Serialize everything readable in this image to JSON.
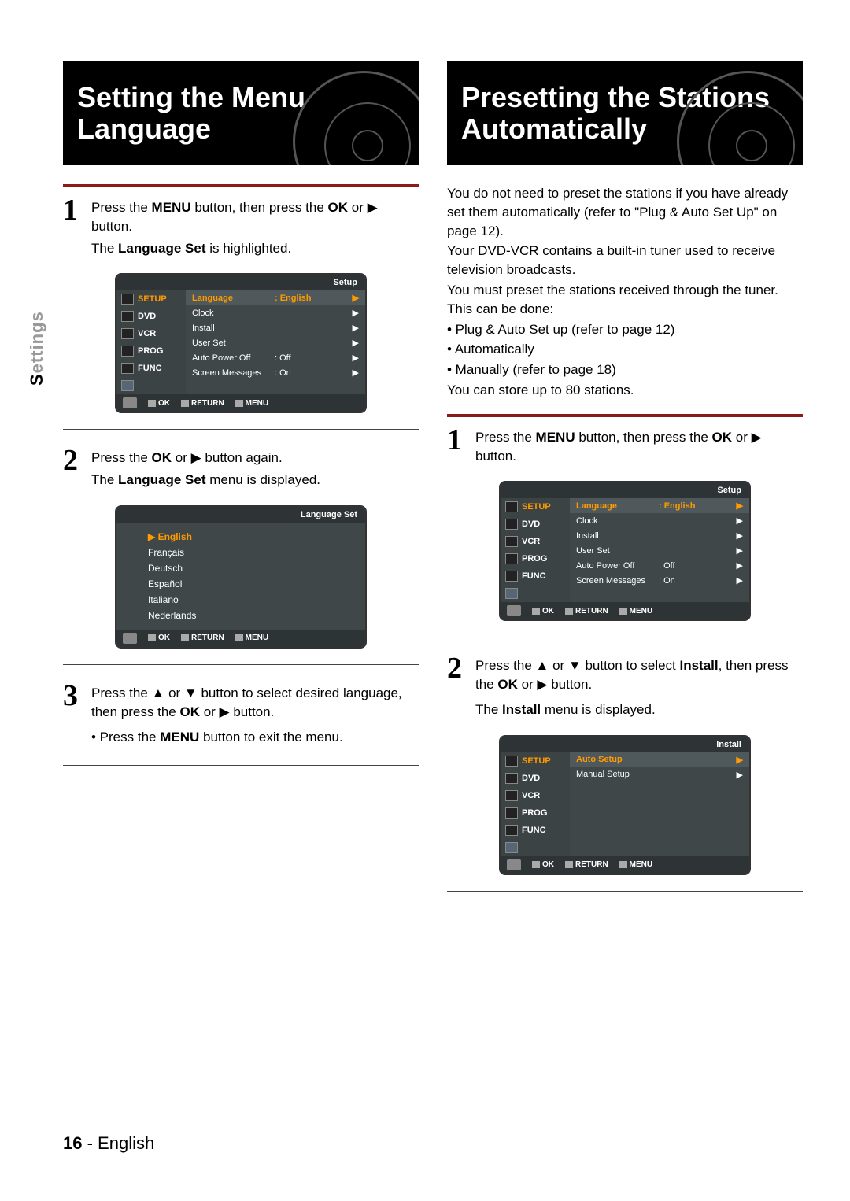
{
  "sideTab": {
    "accent": "S",
    "rest": "ettings"
  },
  "footer": {
    "page": "16",
    "sep": " - ",
    "lang": "English"
  },
  "glyphs": {
    "right": "▶",
    "up": "▲",
    "down": "▼"
  },
  "left": {
    "title": "Setting the Menu Language",
    "step1": {
      "num": "1",
      "line1_a": "Press the ",
      "line1_b": "MENU",
      "line1_c": " button, then press the ",
      "line1_d": "OK",
      "line1_e": " or ▶ button.",
      "line2_a": "The ",
      "line2_b": "Language Set",
      "line2_c": " is highlighted."
    },
    "step2": {
      "num": "2",
      "line1_a": "Press the ",
      "line1_b": "OK",
      "line1_c": " or ▶ button again.",
      "line2_a": "The ",
      "line2_b": "Language Set",
      "line2_c": " menu is displayed."
    },
    "step3": {
      "num": "3",
      "line1": "Press the ▲ or ▼ button to select desired language, then press the ",
      "line1_b": "OK",
      "line1_c": " or ▶ button.",
      "bullet_a": "• Press the ",
      "bullet_b": "MENU",
      "bullet_c": " button to exit the menu."
    }
  },
  "right": {
    "title": "Presetting the Stations Automatically",
    "intro": [
      "You do not need to preset the stations if you have already set them automatically (refer to \"Plug & Auto Set Up\" on page 12).",
      "Your DVD-VCR contains a built-in tuner used to receive television broadcasts.",
      "You must preset the stations received through the tuner. This can be done:",
      "• Plug & Auto Set up (refer to page 12)",
      "• Automatically",
      "• Manually (refer to page 18)",
      "You can store up to 80 stations."
    ],
    "step1": {
      "num": "1",
      "line1_a": "Press the ",
      "line1_b": "MENU",
      "line1_c": " button, then press the ",
      "line1_d": "OK",
      "line1_e": " or ▶ button."
    },
    "step2": {
      "num": "2",
      "line1_a": "Press the ▲ or ▼ button to select ",
      "line1_b": "Install",
      "line1_c": ", then press the ",
      "line1_d": "OK",
      "line1_e": " or ▶ button.",
      "line2_a": "The ",
      "line2_b": "Install",
      "line2_c": " menu is displayed."
    }
  },
  "osd": {
    "setupTitle": "Setup",
    "installTitle": "Install",
    "langSetTitle": "Language Set",
    "side": [
      {
        "label": "SETUP",
        "sel": true
      },
      {
        "label": "DVD"
      },
      {
        "label": "VCR"
      },
      {
        "label": "PROG"
      },
      {
        "label": "FUNC"
      }
    ],
    "setupRows": [
      {
        "label": "Language",
        "value": ": English",
        "sel": true,
        "arrow": true
      },
      {
        "label": "Clock",
        "value": "",
        "arrow": true
      },
      {
        "label": "Install",
        "value": "",
        "arrow": true
      },
      {
        "label": "User Set",
        "value": "",
        "arrow": true
      },
      {
        "label": "Auto Power Off",
        "value": ": Off",
        "arrow": true
      },
      {
        "label": "Screen Messages",
        "value": ": On",
        "arrow": true
      }
    ],
    "installRows": [
      {
        "label": "Auto Setup",
        "value": "",
        "sel": true,
        "arrow": true
      },
      {
        "label": "Manual Setup",
        "value": "",
        "arrow": true
      }
    ],
    "languages": [
      {
        "label": "▶ English",
        "sel": true
      },
      {
        "label": "Français"
      },
      {
        "label": "Deutsch"
      },
      {
        "label": "Español"
      },
      {
        "label": "Italiano"
      },
      {
        "label": "Nederlands"
      }
    ],
    "foot": {
      "ok": "OK",
      "return": "RETURN",
      "menu": "MENU"
    }
  }
}
